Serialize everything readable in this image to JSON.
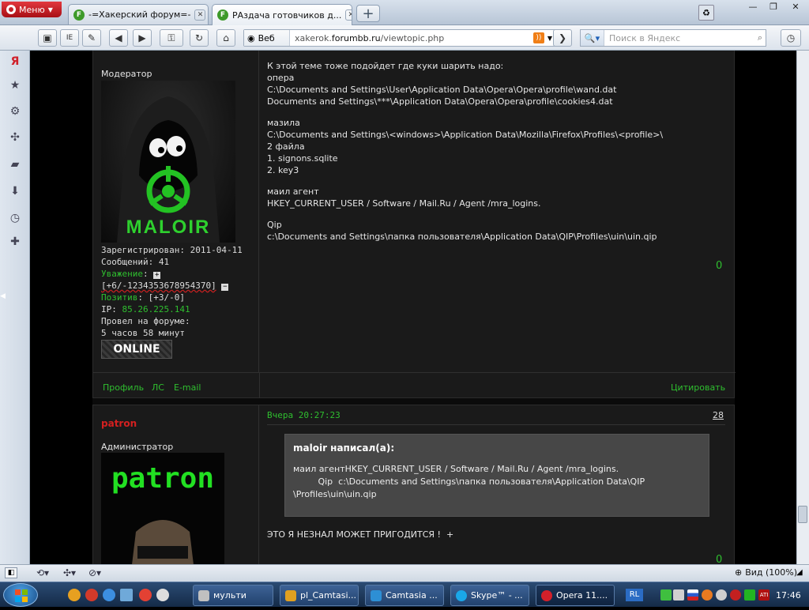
{
  "browser": {
    "menu_label": "Меню",
    "tabs": [
      {
        "title": "-=Хакерский форум=-",
        "favicon": "F"
      },
      {
        "title": "РАздача готовчиков д...",
        "favicon": "F"
      }
    ],
    "newtab_symbol": "+",
    "address": {
      "prefix": "Веб",
      "host_pre": "xakerok.",
      "host": "forumbb.ru",
      "path": "/viewtopic.php"
    },
    "search_placeholder": "Поиск в Яндекс",
    "toolbar_icons": [
      "save-icon",
      "ie-icon",
      "pen-icon",
      "back-icon",
      "forward-icon",
      "key-icon",
      "reload-icon",
      "home-icon",
      "globe-icon"
    ],
    "ie_label": "IE",
    "ya_label": "Я",
    "sidebar_icons": [
      "yandex-icon",
      "bookmarks-icon",
      "settings-icon",
      "fan-icon",
      "notes-icon",
      "downloads-icon",
      "history-icon",
      "add-panel-icon"
    ]
  },
  "post1": {
    "role": "Модератор",
    "avatar_text": "MALOIR",
    "registered": "Зарегистрирован: 2011-04-11",
    "messages": "Сообщений: 41",
    "respect_label": "Уважение",
    "respect_value": "[+6/-1234353678954370]",
    "positive_label": "Позитив",
    "positive_value": "[+3/-0]",
    "ip_label": "IP:",
    "ip_value": "85.26.225.141",
    "time_label": "Провел на форуме:",
    "time_value": "5 часов 58 минут",
    "online_label": "ONLINE",
    "content": [
      "К этой теме тоже подойдет где куки шарить надо:",
      "опера",
      "C:\\Documents and Settings\\User\\Application Data\\Opera\\Opera\\profile\\wand.dat",
      "Documents and Settings\\***\\Application Data\\Opera\\Opera\\profile\\cookies4.dat",
      "",
      "мазила",
      "C:\\Documents and Settings\\<windows>\\Application Data\\Mozilla\\Firefox\\Profiles\\<profile>\\",
      "2 файла",
      "1. signons.sqlite",
      "2. key3",
      "",
      "маил агент",
      "HKEY_CURRENT_USER / Software / Mail.Ru / Agent /mra_logins.",
      "",
      "Qip",
      "c:\\Documents and Settings\\папка пользователя\\Application Data\\QIP\\Profiles\\uin\\uin.qip"
    ],
    "rating": "0",
    "links": {
      "profile": "Профиль",
      "pm": "ЛС",
      "email": "E-mail",
      "quote": "Цитировать"
    }
  },
  "post2": {
    "author": "patron",
    "role": "Администратор",
    "avatar_text": "patron",
    "date": "Вчера 20:27:23",
    "number": "28",
    "quote_title": "maloir написал(а):",
    "quote_lines": [
      "маил агентHKEY_CURRENT_USER / Software / Mail.Ru / Agent /mra_logins.",
      "         Qip  c:\\Documents and Settings\\папка пользователя\\Application Data\\QIP",
      "\\Profiles\\uin\\uin.qip"
    ],
    "text": "ЭТО Я НЕЗНАЛ МОЖЕТ ПРИГОДИТСЯ !  +",
    "rating": "0"
  },
  "status": {
    "zoom": "Вид (100%)"
  },
  "taskbar": {
    "tasks": [
      {
        "label": "мульти",
        "color": "#c0c0c0"
      },
      {
        "label": "pl_Camtasi...",
        "color": "#e0a020"
      },
      {
        "label": "Camtasia ...",
        "color": "#2d8fd5"
      },
      {
        "label": "Skype™ - ...",
        "color": "#1aa7e8"
      },
      {
        "label": "Opera 11....",
        "color": "#d4202a"
      }
    ],
    "lang": "RL",
    "clock": "17:46"
  }
}
